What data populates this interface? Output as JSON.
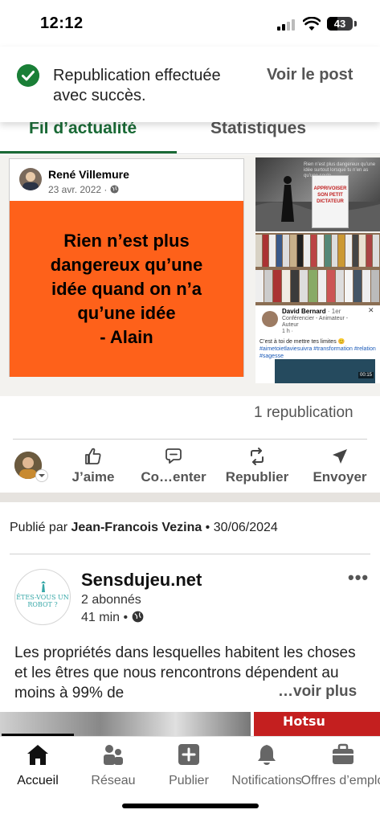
{
  "status_bar": {
    "time": "12:12",
    "battery": "43"
  },
  "toast": {
    "message": "Republication effectuée avec succès.",
    "action": "Voir le post"
  },
  "tabs": [
    {
      "label": "Fil d’actualité"
    },
    {
      "label": "Statistiques"
    }
  ],
  "reshare": {
    "author": "René Villemure",
    "date": "23 avr. 2022 · ",
    "quote": "Rien n’est plus\ndangereux qu’une\nidée quand on n’a\nqu’une idée\n- Alain",
    "thumb1_caption": "Rien n’est plus dangereux qu’une idée surtout lorsque tu n’en as qu’une seule...",
    "book_title": "APPRIVOISER SON PETIT DICTATEUR",
    "thumb3": {
      "name": "David Bernard",
      "degree": "· 1er",
      "role": "Conférencier - Animateur - Auteur",
      "time": "1 h · ",
      "body": "C’est à toi de mettre tes limites 😊",
      "tags": "#aimetoietlaviesuivra #transformation #relation #sagesse",
      "video_time": "00:15"
    },
    "republication_count": "1 republication"
  },
  "actions": [
    {
      "label": "J’aime",
      "icon": "like-icon"
    },
    {
      "label": "Co…enter",
      "icon": "comment-icon"
    },
    {
      "label": "Republier",
      "icon": "repost-icon"
    },
    {
      "label": "Envoyer",
      "icon": "send-icon"
    }
  ],
  "post": {
    "published_prefix": "Publié par ",
    "published_author": "Jean-Francois Vezina",
    "published_date": " • 30/06/2024",
    "org_name": "Sensdujeu.net",
    "org_followers": "2 abonnés",
    "org_time": "41 min • ",
    "logo_text": "ÊTES-VOUS UN ROBOT ?",
    "text": "Les propriétés dans lesquelles habitent les choses et les êtres que nous rencontrons dépendent au moins à 99% de",
    "see_more": "…voir plus",
    "strip_text": "Hotsu"
  },
  "bottom_nav": [
    {
      "label": "Accueil",
      "icon": "home-icon",
      "active": true
    },
    {
      "label": "Réseau",
      "icon": "network-icon"
    },
    {
      "label": "Publier",
      "icon": "add-post-icon"
    },
    {
      "label": "Notifications",
      "icon": "bell-icon"
    },
    {
      "label": "Offres d’emplo",
      "icon": "briefcase-icon"
    }
  ],
  "colors": {
    "brand_green": "#1a6a36",
    "quote_bg": "#fe611a",
    "success": "#1a7f37"
  }
}
